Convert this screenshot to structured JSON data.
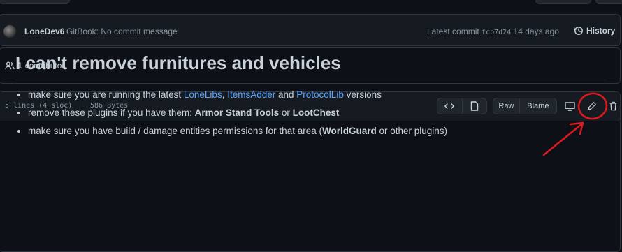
{
  "commit": {
    "author": "LoneDev6",
    "message": "GitBook: No commit message",
    "latest_label": "Latest commit",
    "hash": "fcb7d24",
    "age": "14 days ago",
    "history_label": "History"
  },
  "contributors": {
    "count": "1",
    "label": "contributor"
  },
  "file": {
    "lines": "5 lines (4 sloc)",
    "size": "586 Bytes",
    "raw_label": "Raw",
    "blame_label": "Blame"
  },
  "readme": {
    "title": "I can't remove furnitures and vehicles",
    "item1": {
      "pre": "make sure you are running the latest ",
      "link1": "LoneLibs",
      "sep1": ", ",
      "link2": "ItemsAdder",
      "mid": " and ",
      "link3": "ProtocolLib",
      "post": " versions"
    },
    "item2": {
      "pre": "remove these plugins if you have them: ",
      "b1": "Armor Stand Tools",
      "mid": " or ",
      "b2": "LootChest"
    },
    "item3": {
      "pre": "make sure you have build / damage entities permissions for that area (",
      "b1": "WorldGuard",
      "post": " or other plugins)"
    }
  },
  "annotation_color": "#e0191e",
  "colors": {
    "link": "#58a6ff",
    "text": "#c9d1d9",
    "muted": "#8b949e",
    "border": "#30363d"
  }
}
